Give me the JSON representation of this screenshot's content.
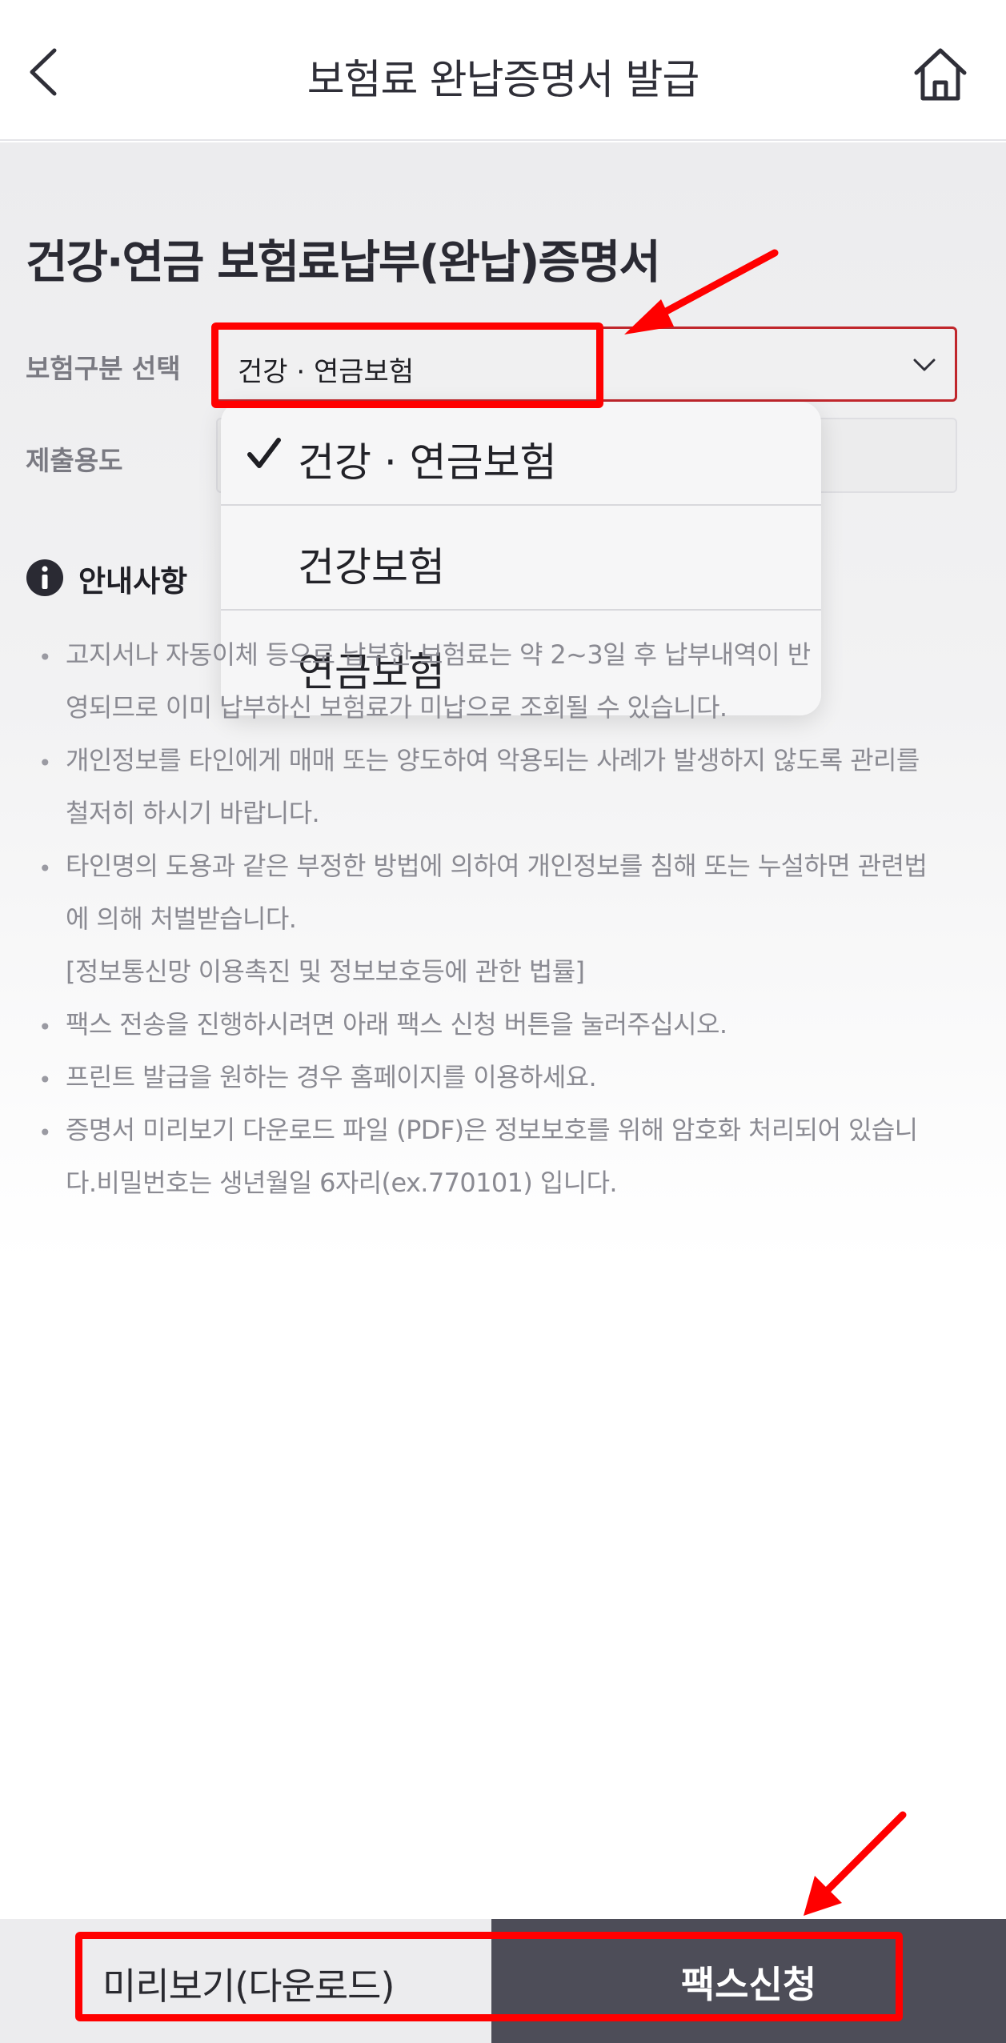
{
  "header": {
    "title": "보험료 완납증명서 발급",
    "back_icon": "chevron-left-icon",
    "home_icon": "home-icon"
  },
  "form": {
    "section_title": "건강·연금 보험료납부(완납)증명서",
    "insurance_label": "보험구분 선택",
    "insurance_selected": "건강 · 연금보험",
    "purpose_label": "제출용도",
    "purpose_value": ""
  },
  "dropdown": {
    "options": [
      {
        "label": "건강 · 연금보험",
        "checked": true
      },
      {
        "label": "건강보험",
        "checked": false
      },
      {
        "label": "연금보험",
        "checked": false
      }
    ]
  },
  "notice": {
    "title": "안내사항",
    "items": [
      {
        "lines": [
          "고지서나 자동이체 등으로 납부한 보험료는 약 2~3일 후 납부내역이 반",
          "영되므로 이미 납부하신 보험료가 미납으로 조회될 수 있습니다."
        ]
      },
      {
        "lines": [
          "개인정보를 타인에게 매매 또는 양도하여 악용되는 사례가 발생하지 않도록 관리를",
          "철저히 하시기 바랍니다."
        ]
      },
      {
        "lines": [
          "타인명의 도용과 같은 부정한 방법에 의하여 개인정보를 침해 또는 누설하면 관련법",
          "에 의해 처벌받습니다.",
          "[정보통신망 이용촉진 및 정보보호등에 관한 법률]"
        ]
      },
      {
        "lines": [
          "팩스 전송을 진행하시려면 아래 팩스 신청 버튼을 눌러주십시오."
        ]
      },
      {
        "lines": [
          "프린트 발급을 원하는 경우 홈페이지를 이용하세요."
        ]
      },
      {
        "lines": [
          "증명서 미리보기 다운로드 파일 (PDF)은 정보보호를 위해 암호화 처리되어 있습니",
          "다.비밀번호는 생년월일 6자리(ex.770101) 입니다."
        ]
      }
    ]
  },
  "footer": {
    "preview_label": "미리보기(다운로드)",
    "fax_label": "팩스신청"
  },
  "colors": {
    "accent_red": "#ff0000",
    "fax_button": "#4d4d58",
    "select_border": "#c0262c"
  }
}
